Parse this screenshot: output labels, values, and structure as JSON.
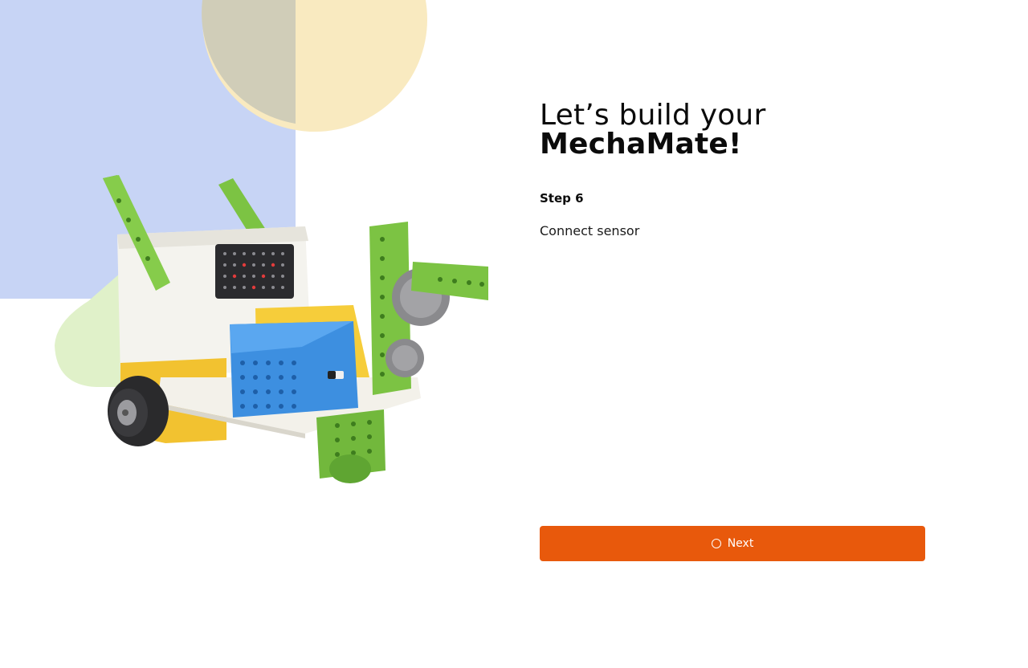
{
  "headline": {
    "line1": "Let’s build your",
    "line2": "MechaMate!"
  },
  "step": {
    "label": "Step 6",
    "description": "Connect sensor"
  },
  "actions": {
    "next_label": "Next",
    "next_icon": "circle-icon"
  },
  "illustration": {
    "subject": "robot-model"
  },
  "colors": {
    "accent": "#e8590c",
    "bg_blue": "#c7d4f5",
    "bg_yellow": "#f9eac0",
    "bg_green": "#e0f1c9"
  }
}
